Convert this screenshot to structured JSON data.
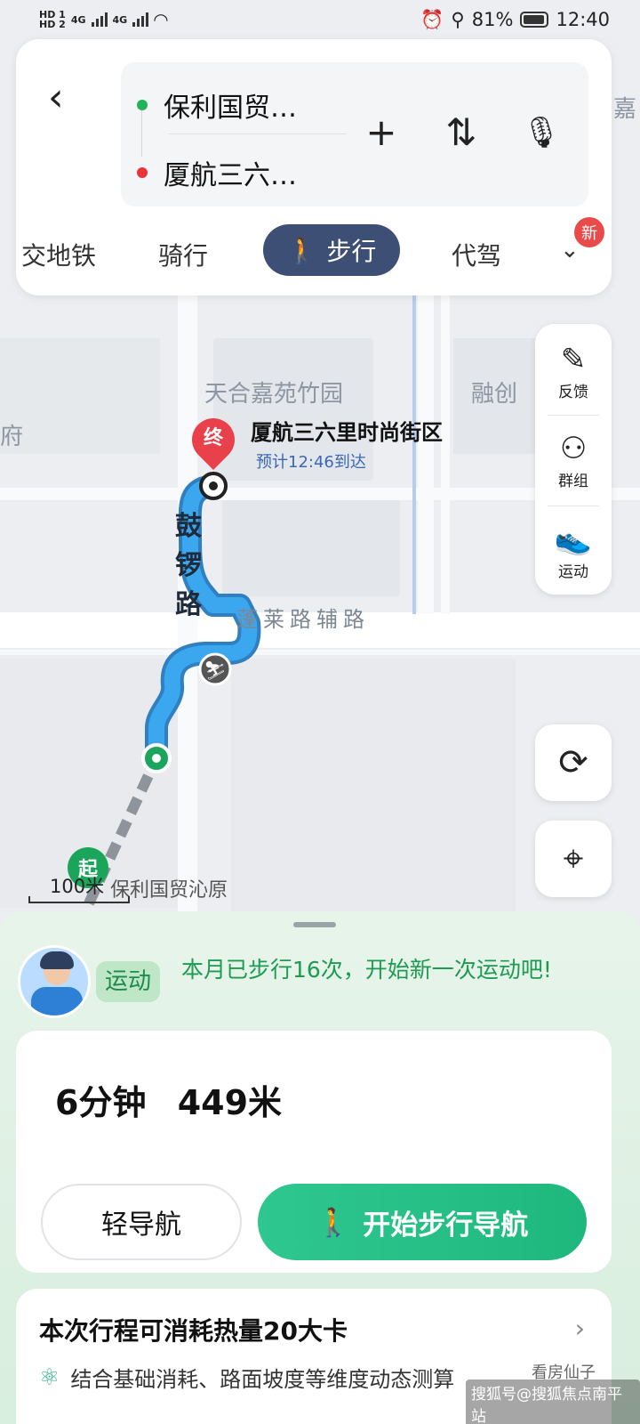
{
  "status_bar": {
    "hd1": "HD 1",
    "hd2": "HD 2",
    "net1": "4G",
    "net2": "4G",
    "battery": "81%",
    "time": "12:40",
    "icons": [
      "alarm-icon",
      "location-icon",
      "leaf-icon"
    ]
  },
  "route": {
    "origin": "保利国贸…",
    "destination": "厦航三六…",
    "add_icon": "+",
    "swap_icon": "⇅",
    "mic_icon": "🎙"
  },
  "modes": {
    "transit": "交地铁",
    "cycling": "骑行",
    "walking": "步行",
    "driver": "代驾",
    "more_badge": "新"
  },
  "map": {
    "poi_1": "天合嘉苑竹园",
    "poi_2": "融创",
    "poi_3": "府",
    "poi_4": "嘉",
    "road_vertical": "鼓锣路",
    "road_horizontal": "蓬莱路辅路",
    "dest_marker": "终",
    "dest_name": "厦航三六里时尚街区",
    "dest_eta": "预计12:46到达",
    "start_marker": "起",
    "start_name": "保利国贸沁原",
    "scale": "100米"
  },
  "side_tools": {
    "feedback": "反馈",
    "group": "群组",
    "sport": "运动"
  },
  "sheet": {
    "sport_tag": "运动",
    "sport_msg": "本月已步行16次，开始新一次运动吧!",
    "duration": "6分钟",
    "distance": "449米",
    "light_nav": "轻导航",
    "start_nav": "开始步行导航",
    "cal_title": "本次行程可消耗热量20大卡",
    "cal_sub": "结合基础消耗、路面坡度等维度动态测算",
    "watermark": "搜狐号@搜狐焦点南平站",
    "watermark2": "看房仙子"
  }
}
